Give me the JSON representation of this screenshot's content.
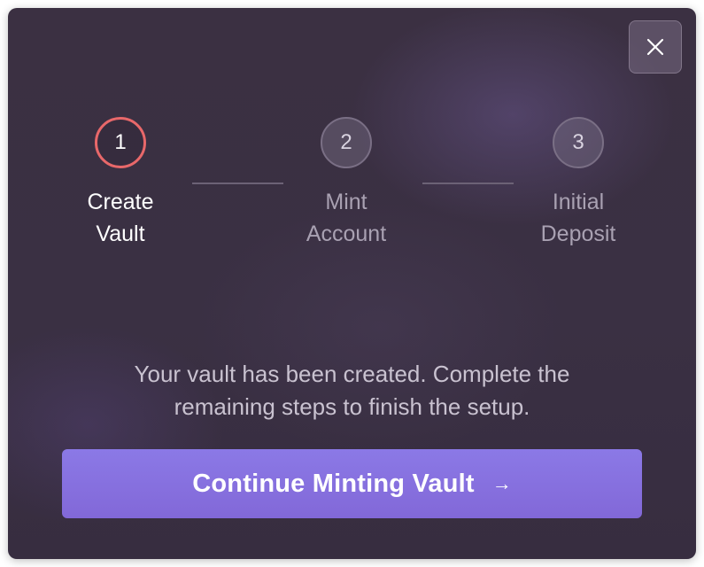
{
  "dialog": {
    "close_icon": "close-icon",
    "steps": [
      {
        "number": "1",
        "label": "Create\nVault",
        "state": "active"
      },
      {
        "number": "2",
        "label": "Mint\nAccount",
        "state": "pending"
      },
      {
        "number": "3",
        "label": "Initial\nDeposit",
        "state": "pending"
      }
    ],
    "message": "Your vault has been created. Complete the\nremaining steps to finish the setup.",
    "cta": {
      "label": "Continue Minting Vault",
      "arrow_icon": "arrow-right-icon",
      "arrow_glyph": "→"
    }
  },
  "colors": {
    "active_step_ring": "#e8686a",
    "cta_background": "#8b79e6",
    "dialog_background": "#3b3042"
  }
}
